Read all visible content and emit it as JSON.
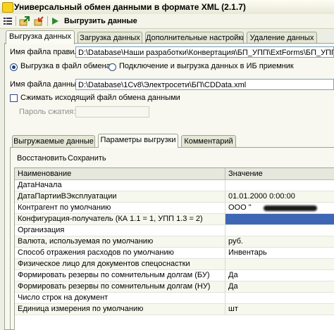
{
  "window": {
    "title": "Универсальный обмен данными в формате XML (2.1.7)"
  },
  "toolbar": {
    "run_label": "Выгрузить данные"
  },
  "main_tabs": [
    "Выгрузка данных",
    "Загрузка данных",
    "Дополнительные настройки",
    "Удаление данных"
  ],
  "export": {
    "rules_file_label": "Имя файла правил:",
    "rules_file_value": "D:\\Database\\Наши разработки\\Конвертация\\БП_УПП\\ExtForms\\БП_УПП.xml",
    "radio_file_label": "Выгрузка в файл обмена",
    "radio_connect_label": "Подключение и выгрузка данных в ИБ приемник",
    "data_file_label": "Имя файла данных:",
    "data_file_value": "D:\\Database\\1Cv8\\Электросети\\БП\\CDData.xml",
    "compress_label": "Сжимать исходящий файл обмена данными",
    "password_label": "Пароль сжатия:",
    "password_value": ""
  },
  "sub_tabs": [
    "Выгружаемые данные",
    "Параметры выгрузки",
    "Комментарий"
  ],
  "actions": {
    "restore": "Восстановить",
    "save": "Сохранить"
  },
  "params_table": {
    "col_name": "Наименование",
    "col_value": "Значение",
    "rows": [
      {
        "name": "ДатаНачала",
        "value": ""
      },
      {
        "name": "ДатаПартииВЭксплуатации",
        "value": "01.01.2000 0:00:00"
      },
      {
        "name": "Контрагент по умолчанию",
        "value": "ООО \""
      },
      {
        "name": "Конфигурация-получатель (КА 1.1 = 1, УПП 1.3 = 2)",
        "value": ""
      },
      {
        "name": "Организация",
        "value": ""
      },
      {
        "name": "Валюта, используемая по умолчанию",
        "value": "руб."
      },
      {
        "name": "Способ отражения расходов по умолчанию",
        "value": "Инвентарь"
      },
      {
        "name": "Физическое лицо для документов спецоснастки",
        "value": ""
      },
      {
        "name": "Формировать резервы по сомнительным долгам (БУ)",
        "value": "Да"
      },
      {
        "name": "Формировать резервы по сомнительным долгам (НУ)",
        "value": "Да"
      },
      {
        "name": "Число строк на документ",
        "value": ""
      },
      {
        "name": "Единица измерения по умолчанию",
        "value": "шт"
      }
    ]
  },
  "colors": {
    "selection": "#3f66b4",
    "accent": "#2f8a2f"
  }
}
